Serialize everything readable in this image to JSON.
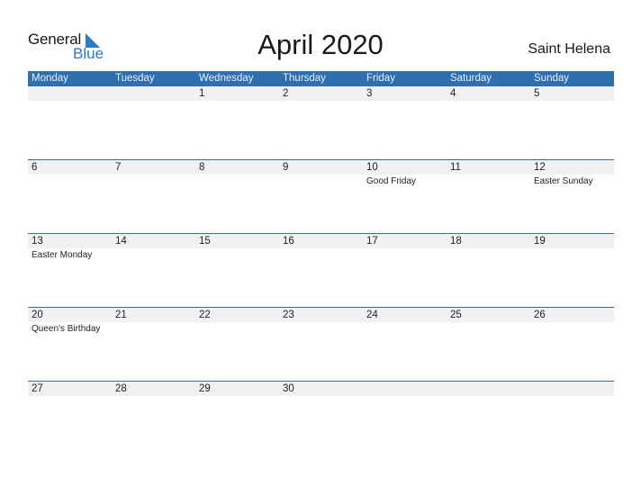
{
  "logo": {
    "line1": "General",
    "line2": "Blue"
  },
  "title": "April 2020",
  "country": "Saint Helena",
  "weekdays": [
    "Monday",
    "Tuesday",
    "Wednesday",
    "Thursday",
    "Friday",
    "Saturday",
    "Sunday"
  ],
  "weeks": [
    {
      "dates": [
        "",
        "",
        "1",
        "2",
        "3",
        "4",
        "5"
      ],
      "events": [
        "",
        "",
        "",
        "",
        "",
        "",
        ""
      ]
    },
    {
      "dates": [
        "6",
        "7",
        "8",
        "9",
        "10",
        "11",
        "12"
      ],
      "events": [
        "",
        "",
        "",
        "",
        "Good Friday",
        "",
        "Easter Sunday"
      ]
    },
    {
      "dates": [
        "13",
        "14",
        "15",
        "16",
        "17",
        "18",
        "19"
      ],
      "events": [
        "Easter Monday",
        "",
        "",
        "",
        "",
        "",
        ""
      ]
    },
    {
      "dates": [
        "20",
        "21",
        "22",
        "23",
        "24",
        "25",
        "26"
      ],
      "events": [
        "Queen's Birthday",
        "",
        "",
        "",
        "",
        "",
        ""
      ]
    },
    {
      "dates": [
        "27",
        "28",
        "29",
        "30",
        "",
        "",
        ""
      ],
      "events": [
        "",
        "",
        "",
        "",
        "",
        "",
        ""
      ]
    }
  ],
  "colors": {
    "header": "#2e6fb0",
    "brand_blue": "#2b7bc9",
    "date_row": "#f1f1f1"
  }
}
